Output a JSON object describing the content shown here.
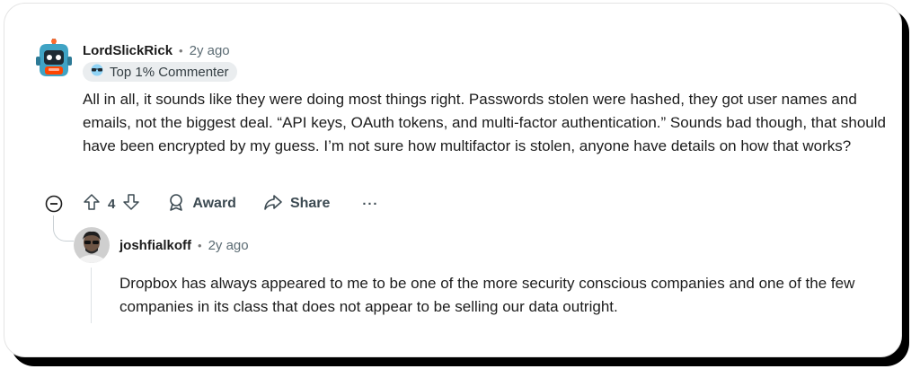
{
  "comment": {
    "author": "LordSlickRick",
    "time": "2y ago",
    "badge": "Top 1% Commenter",
    "body": "All in all, it sounds like they were doing most things right. Passwords stolen were hashed, they got user names and emails, not the biggest deal. “API keys, OAuth tokens, and multi-factor authentication.” Sounds bad though, that should have been encrypted by my guess. I’m not sure how multifactor is stolen, anyone have details on how that works?",
    "score": "4",
    "award_label": "Award",
    "share_label": "Share",
    "more_label": "···"
  },
  "reply": {
    "author": "joshfialkoff",
    "time": "2y ago",
    "body": "Dropbox has always appeared to me to be one of the more security conscious companies and one of the few companies in its class that does not appear to be selling our data outright."
  },
  "separator": "•",
  "icons": {
    "avatar1": "robot-avatar-icon",
    "badge": "glasses-icon",
    "collapse": "collapse-minus-icon",
    "upvote": "upvote-arrow-icon",
    "downvote": "downvote-arrow-icon",
    "award": "award-icon",
    "share": "share-icon"
  },
  "colors": {
    "text": "#1c1c1c",
    "muted": "#5c6c74",
    "action": "#3c4a52",
    "badge_bg": "#eaedef"
  }
}
